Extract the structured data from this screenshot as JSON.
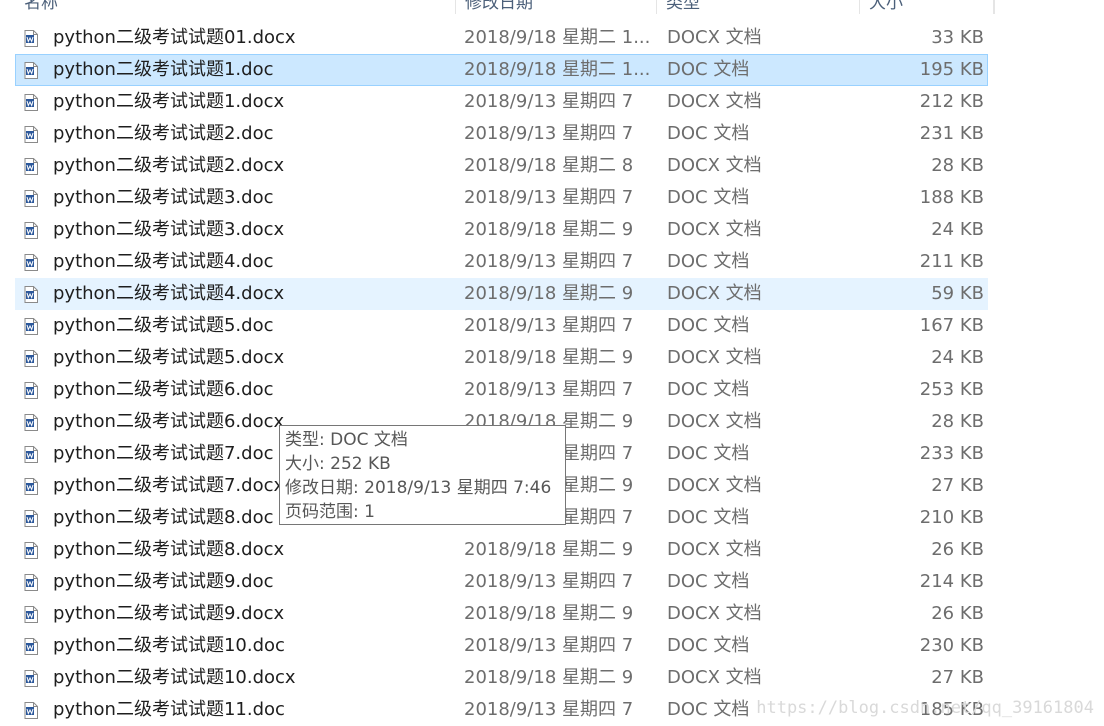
{
  "columns": {
    "name": "名称",
    "date": "修改日期",
    "type": "类型",
    "size": "大小"
  },
  "files": [
    {
      "name": "python二级考试试题01.docx",
      "date": "2018/9/18 星期二 1...",
      "type": "DOCX 文档",
      "size": "33 KB",
      "state": ""
    },
    {
      "name": "python二级考试试题1.doc",
      "date": "2018/9/18 星期二 1...",
      "type": "DOC 文档",
      "size": "195 KB",
      "state": "selected"
    },
    {
      "name": "python二级考试试题1.docx",
      "date": "2018/9/13 星期四 7",
      "type": "DOCX 文档",
      "size": "212 KB",
      "state": ""
    },
    {
      "name": "python二级考试试题2.doc",
      "date": "2018/9/13 星期四 7",
      "type": "DOC 文档",
      "size": "231 KB",
      "state": ""
    },
    {
      "name": "python二级考试试题2.docx",
      "date": "2018/9/18 星期二 8",
      "type": "DOCX 文档",
      "size": "28 KB",
      "state": ""
    },
    {
      "name": "python二级考试试题3.doc",
      "date": "2018/9/13 星期四 7",
      "type": "DOC 文档",
      "size": "188 KB",
      "state": ""
    },
    {
      "name": "python二级考试试题3.docx",
      "date": "2018/9/18 星期二 9",
      "type": "DOCX 文档",
      "size": "24 KB",
      "state": ""
    },
    {
      "name": "python二级考试试题4.doc",
      "date": "2018/9/13 星期四 7",
      "type": "DOC 文档",
      "size": "211 KB",
      "state": ""
    },
    {
      "name": "python二级考试试题4.docx",
      "date": "2018/9/18 星期二 9",
      "type": "DOCX 文档",
      "size": "59 KB",
      "state": "hover"
    },
    {
      "name": "python二级考试试题5.doc",
      "date": "2018/9/13 星期四 7",
      "type": "DOC 文档",
      "size": "167 KB",
      "state": ""
    },
    {
      "name": "python二级考试试题5.docx",
      "date": "2018/9/18 星期二 9",
      "type": "DOCX 文档",
      "size": "24 KB",
      "state": ""
    },
    {
      "name": "python二级考试试题6.doc",
      "date": "2018/9/13 星期四 7",
      "type": "DOC 文档",
      "size": "253 KB",
      "state": ""
    },
    {
      "name": "python二级考试试题6.docx",
      "date": "2018/9/18 星期二 9",
      "type": "DOCX 文档",
      "size": "28 KB",
      "state": ""
    },
    {
      "name": "python二级考试试题7.doc",
      "date": "2018/9/13 星期四 7",
      "type": "DOC 文档",
      "size": "233 KB",
      "state": ""
    },
    {
      "name": "python二级考试试题7.docx",
      "date": "2018/9/18 星期二 9",
      "type": "DOCX 文档",
      "size": "27 KB",
      "state": ""
    },
    {
      "name": "python二级考试试题8.doc",
      "date": "2018/9/13 星期四 7",
      "type": "DOC 文档",
      "size": "210 KB",
      "state": ""
    },
    {
      "name": "python二级考试试题8.docx",
      "date": "2018/9/18 星期二 9",
      "type": "DOCX 文档",
      "size": "26 KB",
      "state": ""
    },
    {
      "name": "python二级考试试题9.doc",
      "date": "2018/9/13 星期四 7",
      "type": "DOC 文档",
      "size": "214 KB",
      "state": ""
    },
    {
      "name": "python二级考试试题9.docx",
      "date": "2018/9/18 星期二 9",
      "type": "DOCX 文档",
      "size": "26 KB",
      "state": ""
    },
    {
      "name": "python二级考试试题10.doc",
      "date": "2018/9/13 星期四 7",
      "type": "DOC 文档",
      "size": "230 KB",
      "state": ""
    },
    {
      "name": "python二级考试试题10.docx",
      "date": "2018/9/18 星期二 9",
      "type": "DOCX 文档",
      "size": "27 KB",
      "state": ""
    },
    {
      "name": "python二级考试试题11.doc",
      "date": "2018/9/13 星期四 7",
      "type": "DOC 文档",
      "size": "185 KB",
      "state": ""
    }
  ],
  "tooltip": {
    "type_line": "类型: DOC 文档",
    "size_line": "大小: 252 KB",
    "modified_line": "修改日期: 2018/9/13 星期四 7:46",
    "pages_line": "页码范围: 1"
  },
  "watermark": "https://blog.csdn.net/qq_39161804",
  "colors": {
    "word_icon_blue": "#2b579a",
    "selected_bg": "#cce8ff",
    "hover_bg": "#e5f3ff"
  },
  "icon": "word-document-icon"
}
